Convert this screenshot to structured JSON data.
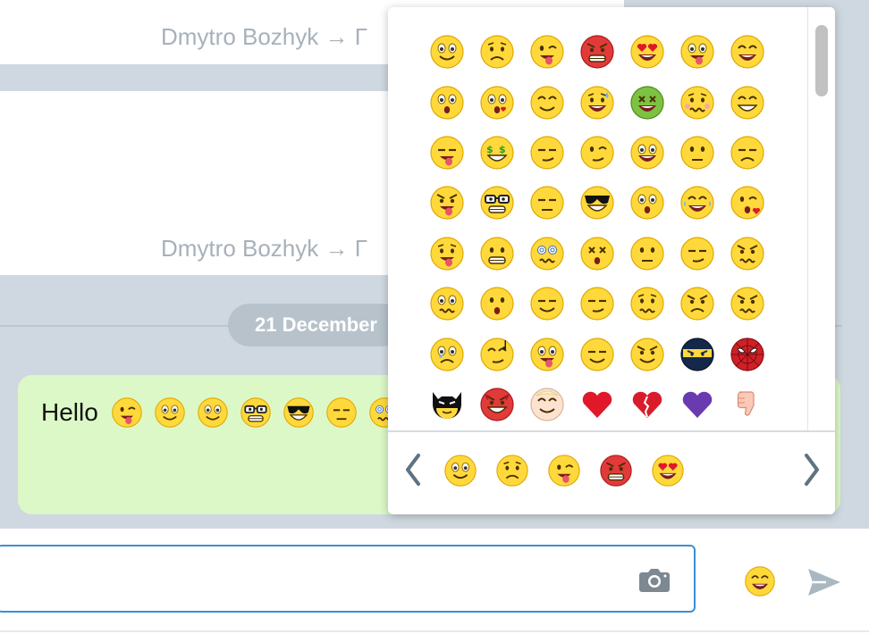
{
  "messages": {
    "route_text_1": "Dmytro Bozhyk → Г",
    "route_text_2": "Dmytro Bozhyk → Г",
    "date_separator": "21 December",
    "bubble": {
      "text": "Hello",
      "emojis": [
        "wink-tongue",
        "smile",
        "angry-tongue",
        "nerd-glasses",
        "sunglasses",
        "meh",
        "dizzy"
      ]
    }
  },
  "emoji_picker": {
    "grid": [
      [
        "smile",
        "sad",
        "wink-tongue",
        "angry-red",
        "heart-eyes",
        "tongue",
        "laugh"
      ],
      [
        "shocked",
        "kiss-lashes",
        "content",
        "cry-sweat",
        "sick-green",
        "worried-blush",
        "grin-big"
      ],
      [
        "drool",
        "money-eyes",
        "smirk",
        "wink",
        "scared-open",
        "frown",
        "pensive"
      ],
      [
        "furious-tongue",
        "nerd-glasses",
        "meh",
        "sunglasses",
        "surprised",
        "laugh-tears",
        "blow-kiss"
      ],
      [
        "tongue-out",
        "grimace",
        "dizzy",
        "x-eyes",
        "neutral",
        "rolling-eyes",
        "annoyed"
      ],
      [
        "confused",
        "o-mouth",
        "half-smile",
        "unamused",
        "anxious",
        "angry",
        "frustrated"
      ],
      [
        "teary-puppy",
        "music-note",
        "crazy",
        "smug",
        "devilish",
        "ninja",
        "spider"
      ],
      [
        "batman",
        "devil",
        "angel",
        "red-heart",
        "broken-heart",
        "purple-heart",
        "thumbs-down"
      ]
    ],
    "recent": [
      "smile",
      "sad",
      "wink-tongue",
      "angry-red",
      "heart-eyes"
    ]
  },
  "composer": {
    "input_value": "",
    "input_placeholder": ""
  }
}
